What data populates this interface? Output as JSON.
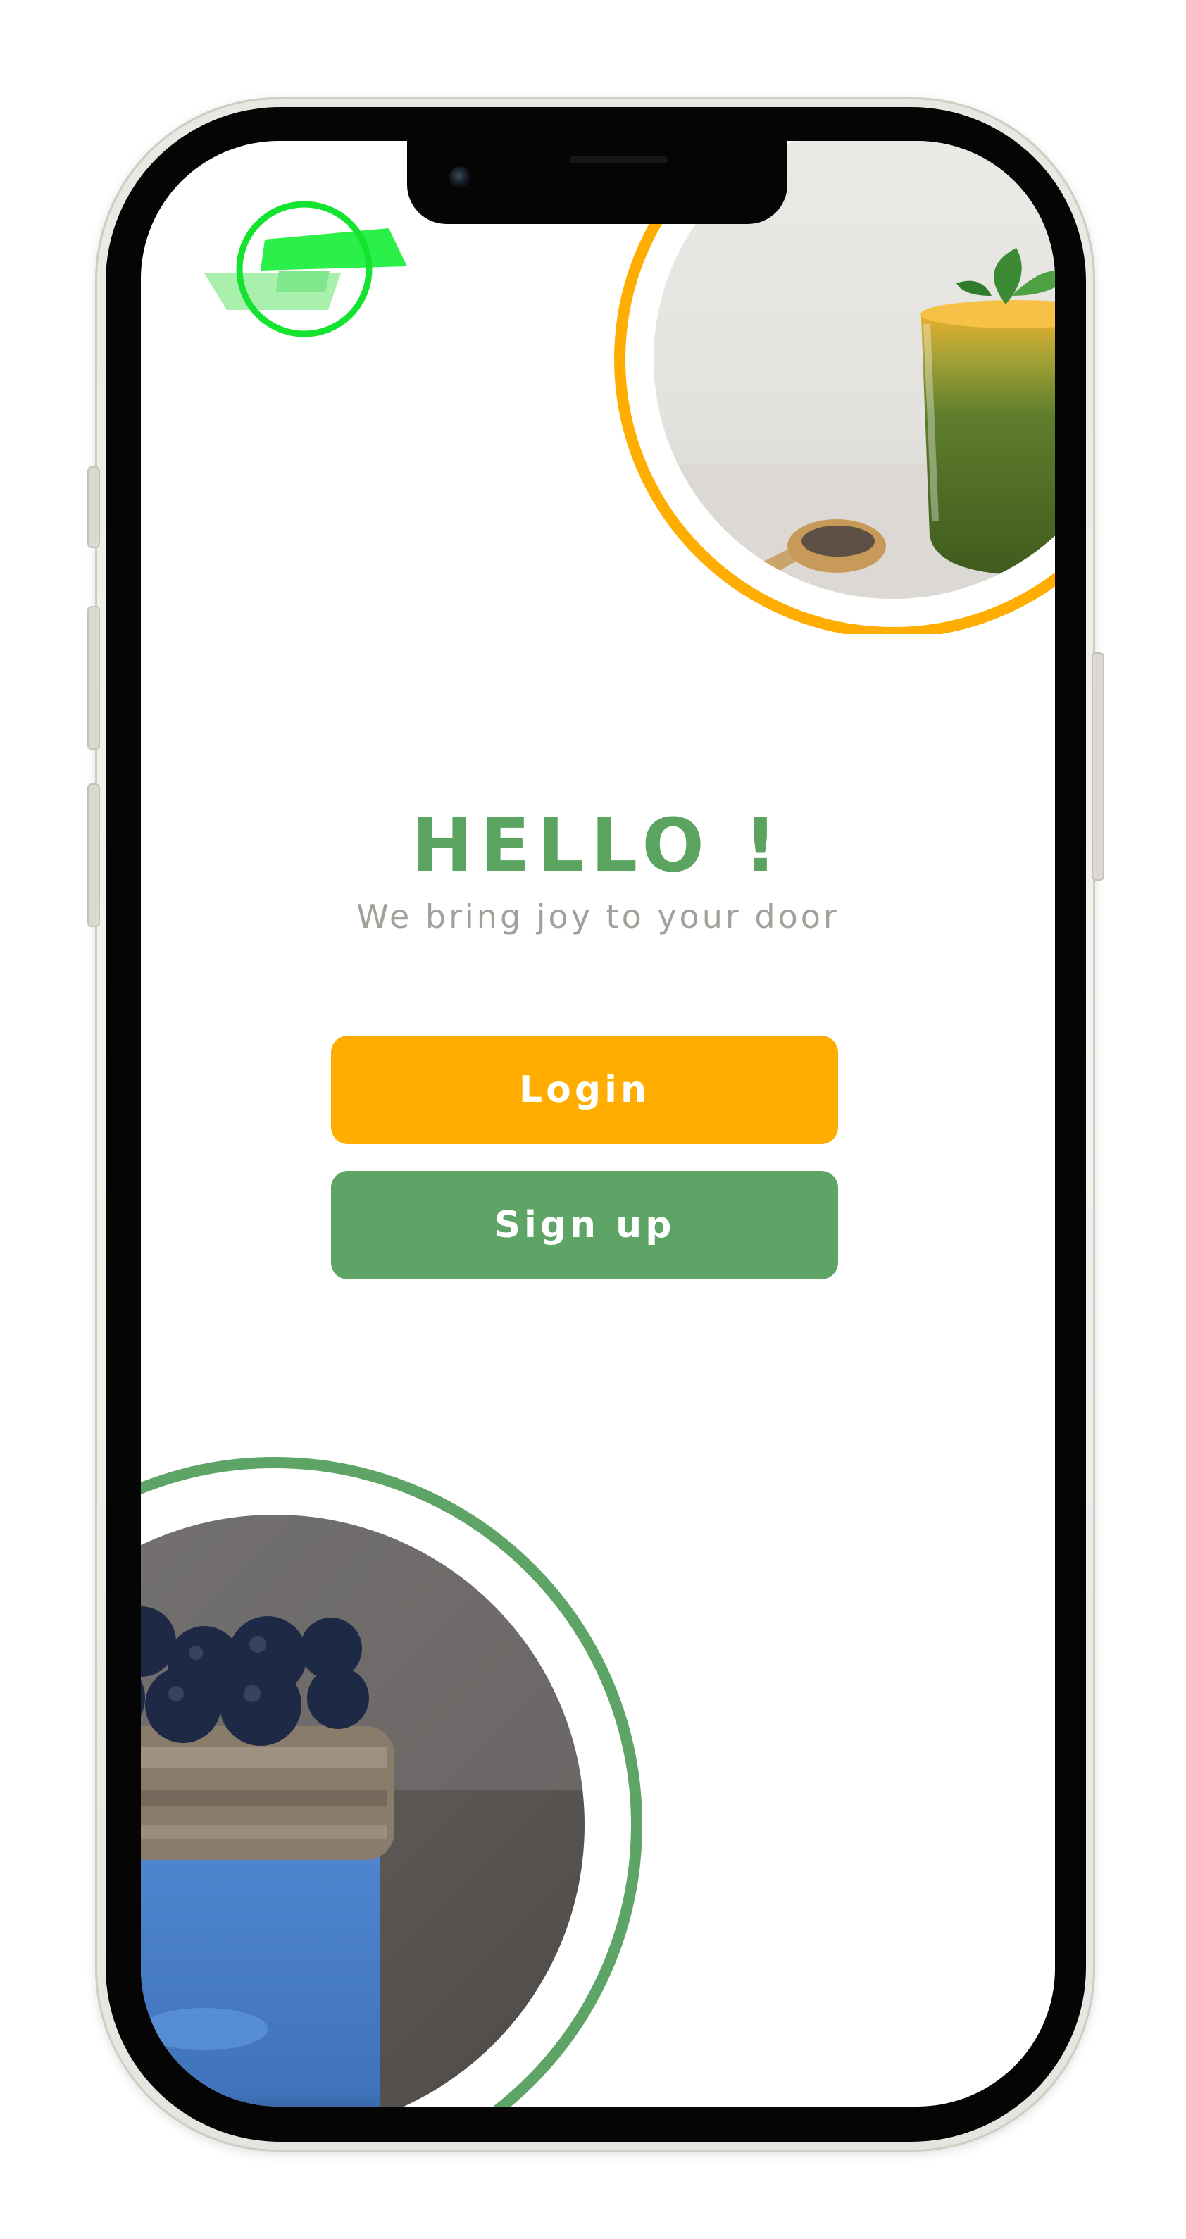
{
  "app": {
    "colors": {
      "brand_green": "#5ea466",
      "accent_orange": "#ffad00",
      "logo_green": "#22dd3c",
      "tagline_gray": "#a3a09a"
    },
    "logo": {
      "icon": "app-logo-icon"
    },
    "hero_top_image": {
      "icon": "smoothie-photo",
      "ring_color": "#ffad00"
    },
    "hero_bottom_image": {
      "icon": "blueberry-jar-photo",
      "ring_color": "#5ea466"
    },
    "greeting": {
      "title": "HELLO !",
      "subtitle": "We bring joy to your door"
    },
    "actions": {
      "login_label": "Login",
      "signup_label": "Sign up"
    }
  }
}
